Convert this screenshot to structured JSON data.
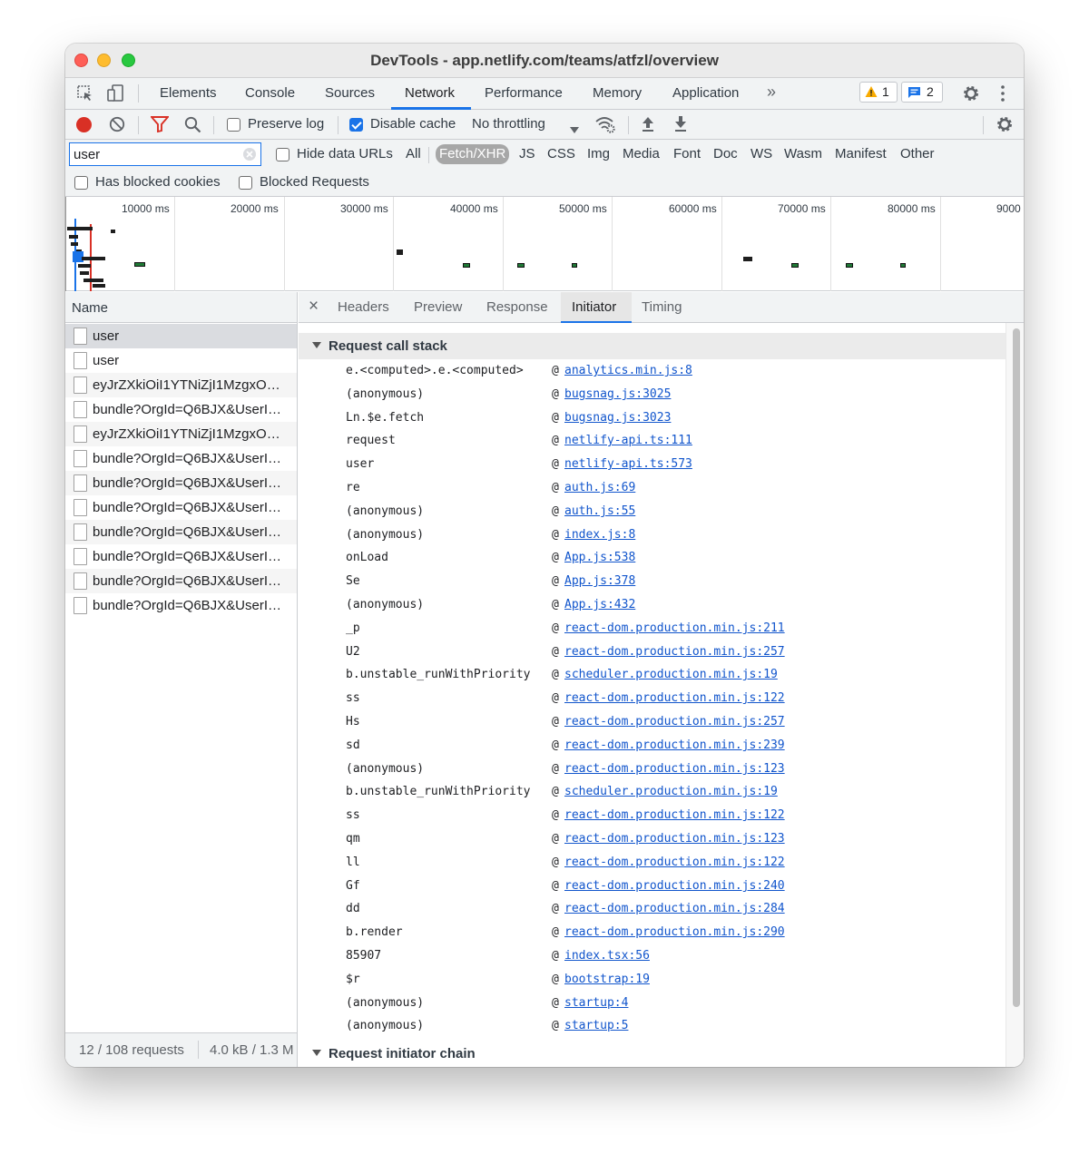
{
  "window": {
    "title": "DevTools - app.netlify.com/teams/atfzl/overview"
  },
  "tabs": {
    "items": [
      "Elements",
      "Console",
      "Sources",
      "Network",
      "Performance",
      "Memory",
      "Application"
    ],
    "active": "Network",
    "more": "»",
    "warnings_count": "1",
    "messages_count": "2"
  },
  "toolbar": {
    "preserve_log_label": "Preserve log",
    "preserve_log_checked": false,
    "disable_cache_label": "Disable cache",
    "disable_cache_checked": true,
    "throttling_value": "No throttling"
  },
  "filter": {
    "search_value": "user",
    "hide_data_urls_label": "Hide data URLs",
    "types": [
      "All",
      "Fetch/XHR",
      "JS",
      "CSS",
      "Img",
      "Media",
      "Font",
      "Doc",
      "WS",
      "Wasm",
      "Manifest",
      "Other"
    ],
    "active_type": "Fetch/XHR",
    "has_blocked_cookies_label": "Has blocked cookies",
    "blocked_requests_label": "Blocked Requests"
  },
  "overview": {
    "tick_labels": [
      "10000 ms",
      "20000 ms",
      "30000 ms",
      "40000 ms",
      "50000 ms",
      "60000 ms",
      "70000 ms",
      "80000 ms",
      "9000"
    ]
  },
  "requests": {
    "header": "Name",
    "items": [
      "user",
      "user",
      "eyJrZXkiOiI1YTNiZjI1MzgxO…",
      "bundle?OrgId=Q6BJX&UserI…",
      "eyJrZXkiOiI1YTNiZjI1MzgxO…",
      "bundle?OrgId=Q6BJX&UserI…",
      "bundle?OrgId=Q6BJX&UserI…",
      "bundle?OrgId=Q6BJX&UserI…",
      "bundle?OrgId=Q6BJX&UserI…",
      "bundle?OrgId=Q6BJX&UserI…",
      "bundle?OrgId=Q6BJX&UserI…",
      "bundle?OrgId=Q6BJX&UserI…"
    ],
    "footer_requests": "12 / 108 requests",
    "footer_size": "4.0 kB / 1.3 M"
  },
  "details": {
    "close": "×",
    "tabs": [
      "Headers",
      "Preview",
      "Response",
      "Initiator",
      "Timing"
    ],
    "active_tab": "Initiator",
    "call_stack_title": "Request call stack",
    "initiator_chain_title": "Request initiator chain",
    "at_symbol": "@",
    "frames": [
      {
        "fn": "e.<computed>.e.<computed>",
        "loc": "analytics.min.js:8"
      },
      {
        "fn": "(anonymous)",
        "loc": "bugsnag.js:3025"
      },
      {
        "fn": "Ln.$e.fetch",
        "loc": "bugsnag.js:3023"
      },
      {
        "fn": "request",
        "loc": "netlify-api.ts:111"
      },
      {
        "fn": "user",
        "loc": "netlify-api.ts:573"
      },
      {
        "fn": "re",
        "loc": "auth.js:69"
      },
      {
        "fn": "(anonymous)",
        "loc": "auth.js:55"
      },
      {
        "fn": "(anonymous)",
        "loc": "index.js:8"
      },
      {
        "fn": "onLoad",
        "loc": "App.js:538"
      },
      {
        "fn": "Se",
        "loc": "App.js:378"
      },
      {
        "fn": "(anonymous)",
        "loc": "App.js:432"
      },
      {
        "fn": "_p",
        "loc": "react-dom.production.min.js:211"
      },
      {
        "fn": "U2",
        "loc": "react-dom.production.min.js:257"
      },
      {
        "fn": "b.unstable_runWithPriority",
        "loc": "scheduler.production.min.js:19"
      },
      {
        "fn": "ss",
        "loc": "react-dom.production.min.js:122"
      },
      {
        "fn": "Hs",
        "loc": "react-dom.production.min.js:257"
      },
      {
        "fn": "sd",
        "loc": "react-dom.production.min.js:239"
      },
      {
        "fn": "(anonymous)",
        "loc": "react-dom.production.min.js:123"
      },
      {
        "fn": "b.unstable_runWithPriority",
        "loc": "scheduler.production.min.js:19"
      },
      {
        "fn": "ss",
        "loc": "react-dom.production.min.js:122"
      },
      {
        "fn": "qm",
        "loc": "react-dom.production.min.js:123"
      },
      {
        "fn": "ll",
        "loc": "react-dom.production.min.js:122"
      },
      {
        "fn": "Gf",
        "loc": "react-dom.production.min.js:240"
      },
      {
        "fn": "dd",
        "loc": "react-dom.production.min.js:284"
      },
      {
        "fn": "b.render",
        "loc": "react-dom.production.min.js:290"
      },
      {
        "fn": "85907",
        "loc": "index.tsx:56"
      },
      {
        "fn": "$r",
        "loc": "bootstrap:19"
      },
      {
        "fn": "(anonymous)",
        "loc": "startup:4"
      },
      {
        "fn": "(anonymous)",
        "loc": "startup:5"
      }
    ]
  },
  "colors": {
    "accent": "#1a73e8",
    "record": "#d93025",
    "filter_icon": "#d93025",
    "link": "#1155cc",
    "warning": "#f9ab00"
  }
}
